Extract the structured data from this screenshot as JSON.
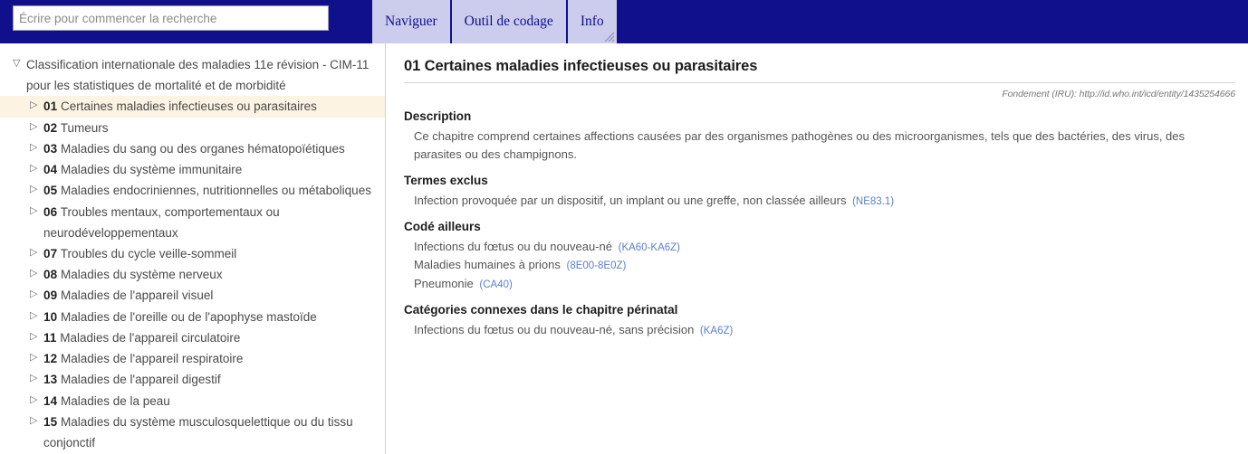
{
  "topbar": {
    "search": {
      "placeholder": "Écrire pour commencer la recherche",
      "value": ""
    },
    "tabs": [
      {
        "label": "Naviguer",
        "active": false
      },
      {
        "label": "Outil de codage",
        "active": false
      },
      {
        "label": "Info",
        "active": true,
        "icon": "resize-grip-icon"
      }
    ],
    "background_color": "#10108c",
    "tab_background_color": "#ccccec",
    "tab_text_color": "#10108c"
  },
  "sidebar": {
    "root": {
      "twisty": "▽",
      "label": "Classification internationale des maladies 11e révision - CIM-11 pour les statistiques de mortalité et de morbidité",
      "expanded": true
    },
    "items": [
      {
        "twisty": "▷",
        "code": "01",
        "label": "Certaines maladies infectieuses ou parasitaires",
        "selected": true
      },
      {
        "twisty": "▷",
        "code": "02",
        "label": "Tumeurs",
        "selected": false
      },
      {
        "twisty": "▷",
        "code": "03",
        "label": "Maladies du sang ou des organes hématopoïétiques",
        "selected": false
      },
      {
        "twisty": "▷",
        "code": "04",
        "label": "Maladies du système immunitaire",
        "selected": false
      },
      {
        "twisty": "▷",
        "code": "05",
        "label": "Maladies endocriniennes, nutritionnelles ou métaboliques",
        "selected": false
      },
      {
        "twisty": "▷",
        "code": "06",
        "label": "Troubles mentaux, comportementaux ou neurodéveloppementaux",
        "selected": false
      },
      {
        "twisty": "▷",
        "code": "07",
        "label": "Troubles du cycle veille-sommeil",
        "selected": false
      },
      {
        "twisty": "▷",
        "code": "08",
        "label": "Maladies du système nerveux",
        "selected": false
      },
      {
        "twisty": "▷",
        "code": "09",
        "label": "Maladies de l'appareil visuel",
        "selected": false
      },
      {
        "twisty": "▷",
        "code": "10",
        "label": "Maladies de l'oreille ou de l'apophyse mastoïde",
        "selected": false
      },
      {
        "twisty": "▷",
        "code": "11",
        "label": "Maladies de l'appareil circulatoire",
        "selected": false
      },
      {
        "twisty": "▷",
        "code": "12",
        "label": "Maladies de l'appareil respiratoire",
        "selected": false
      },
      {
        "twisty": "▷",
        "code": "13",
        "label": "Maladies de l'appareil digestif",
        "selected": false
      },
      {
        "twisty": "▷",
        "code": "14",
        "label": "Maladies de la peau",
        "selected": false
      },
      {
        "twisty": "▷",
        "code": "15",
        "label": "Maladies du système musculosquelettique ou du tissu conjonctif",
        "selected": false
      }
    ],
    "selected_background_color": "#fcf3e3"
  },
  "content": {
    "title": "01 Certaines maladies infectieuses ou parasitaires",
    "uri_line": "Fondement (IRU): http://id.who.int/icd/entity/1435254666",
    "sections": {
      "description": {
        "title": "Description",
        "text": "Ce chapitre comprend certaines affections causées par des organismes pathogènes ou des microorganismes, tels que des bactéries, des virus, des parasites ou des champignons."
      },
      "exclusions": {
        "title": "Termes exclus",
        "entries": [
          {
            "text": "Infection provoquée par un dispositif, un implant ou une greffe, non classée ailleurs",
            "code": "(NE83.1)"
          }
        ]
      },
      "coded_elsewhere": {
        "title": "Codé ailleurs",
        "entries": [
          {
            "text": "Infections du fœtus ou du nouveau-né",
            "code": "(KA60-KA6Z)"
          },
          {
            "text": "Maladies humaines à prions",
            "code": "(8E00-8E0Z)"
          },
          {
            "text": "Pneumonie",
            "code": "(CA40)"
          }
        ]
      },
      "perinatal": {
        "title": "Catégories connexes dans le chapitre périnatal",
        "entries": [
          {
            "text": "Infections du fœtus ou du nouveau-né, sans précision",
            "code": "(KA6Z)"
          }
        ]
      }
    },
    "link_color": "#5b7fcc"
  }
}
